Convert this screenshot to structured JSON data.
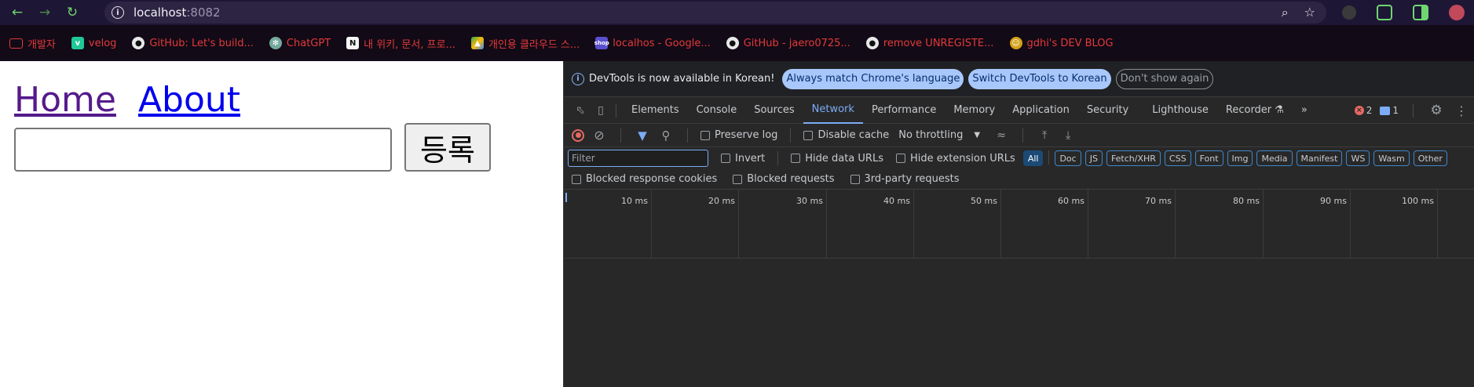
{
  "browser": {
    "url_host": "localhost",
    "url_port": ":8082",
    "bookmarks": [
      {
        "label": "개발자",
        "icon": "folder-icon"
      },
      {
        "label": "velog",
        "icon": "velog-icon"
      },
      {
        "label": "GitHub: Let's build...",
        "icon": "github-icon"
      },
      {
        "label": "ChatGPT",
        "icon": "chatgpt-icon"
      },
      {
        "label": "내 위키, 문서, 프로...",
        "icon": "notion-icon"
      },
      {
        "label": "개인용 클라우드 스...",
        "icon": "google-drive-icon"
      },
      {
        "label": "localhos - Google...",
        "icon": "shop-icon"
      },
      {
        "label": "GitHub - jaero0725...",
        "icon": "github-icon"
      },
      {
        "label": "remove UNREGISTE...",
        "icon": "github-icon"
      },
      {
        "label": "gdhi's DEV BLOG",
        "icon": "blog-icon"
      }
    ]
  },
  "page": {
    "home_link": "Home",
    "about_link": "About",
    "input_value": "",
    "submit_label": "등록"
  },
  "devtools": {
    "infobar": {
      "message": "DevTools is now available in Korean!",
      "match_button": "Always match Chrome's language",
      "switch_button": "Switch DevTools to Korean",
      "dismiss_button": "Don't show again"
    },
    "tabs": [
      "Elements",
      "Console",
      "Sources",
      "Network",
      "Performance",
      "Memory",
      "Application",
      "Security",
      "Lighthouse",
      "Recorder"
    ],
    "active_tab": "Network",
    "error_count": "2",
    "message_count": "1",
    "controls": {
      "preserve_log": "Preserve log",
      "disable_cache": "Disable cache",
      "throttling": "No throttling"
    },
    "filter": {
      "placeholder": "Filter",
      "invert": "Invert",
      "hide_data_urls": "Hide data URLs",
      "hide_extension_urls": "Hide extension URLs",
      "types": [
        "All",
        "Doc",
        "JS",
        "Fetch/XHR",
        "CSS",
        "Font",
        "Img",
        "Media",
        "Manifest",
        "WS",
        "Wasm",
        "Other"
      ],
      "active_type": "All"
    },
    "filters2": {
      "blocked_cookies": "Blocked response cookies",
      "blocked_requests": "Blocked requests",
      "third_party": "3rd-party requests"
    },
    "timeline_ticks": [
      "10 ms",
      "20 ms",
      "30 ms",
      "40 ms",
      "50 ms",
      "60 ms",
      "70 ms",
      "80 ms",
      "90 ms",
      "100 ms"
    ]
  }
}
